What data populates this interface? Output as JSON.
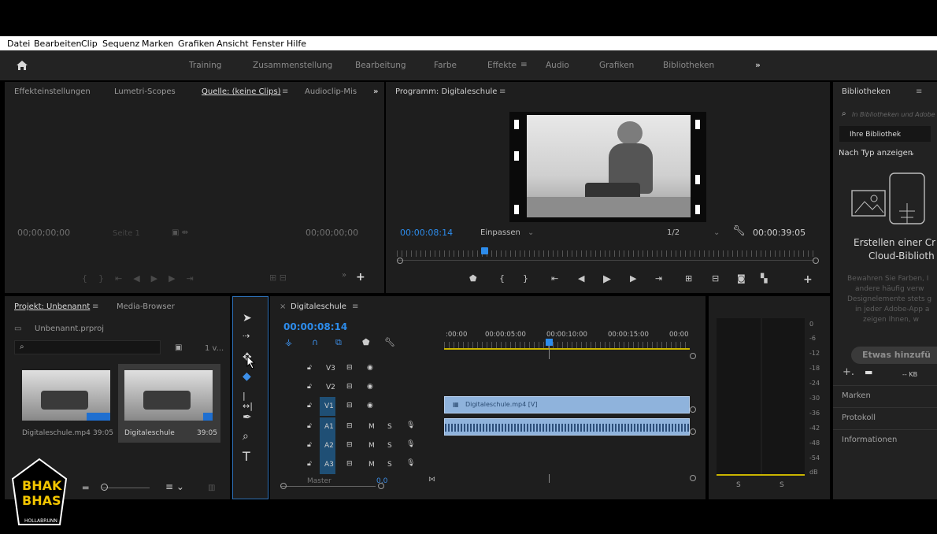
{
  "menu": [
    "Datei",
    "Bearbeiten",
    "Clip",
    "Sequenz",
    "Marken",
    "Grafiken",
    "Ansicht",
    "Fenster",
    "Hilfe"
  ],
  "workspaces": {
    "items": [
      "Training",
      "Zusammenstellung",
      "Bearbeitung",
      "Farbe",
      "Effekte",
      "Audio",
      "Grafiken",
      "Bibliotheken"
    ],
    "active": "Effekte",
    "more": "»"
  },
  "source_panel": {
    "tabs": [
      "Effekteinstellungen",
      "Lumetri-Scopes",
      "Quelle: (keine Clips)",
      "Audioclip-Mis"
    ],
    "active_tab": "Quelle: (keine Clips)",
    "timecode_left": "00;00;00;00",
    "page": "Seite 1",
    "timecode_right": "00;00;00;00"
  },
  "program_panel": {
    "title": "Programm: Digitaleschule",
    "timecode": "00:00:08:14",
    "fit": "Einpassen",
    "resolution": "1/2",
    "duration": "00:00:39:05",
    "playhead_fraction": 0.21
  },
  "libraries_panel": {
    "title": "Bibliotheken",
    "search_placeholder": "In Bibliotheken und Adobe",
    "library": "Ihre Bibliothek",
    "filter": "Nach Typ anzeigen",
    "heading": "Erstellen einer Cloud-Bibliothek",
    "heading_line1": "Erstellen einer Cr",
    "heading_line2": "Cloud-Biblioth",
    "desc_lines": [
      "Bewahren Sie Farben, I",
      "andere häufig verw",
      "Designelemente stets g",
      "in jeder Adobe-App a",
      "zeigen Ihnen, w"
    ],
    "add_button": "Etwas hinzufü",
    "kb": "-- KB",
    "sections": [
      "Marken",
      "Protokoll",
      "Informationen"
    ]
  },
  "project_panel": {
    "tabs": [
      "Projekt: Unbenannt",
      "Media-Browser"
    ],
    "file": "Unbenannt.prproj",
    "count": "1 v...",
    "items": [
      {
        "name": "Digitaleschule.mp4",
        "duration": "39:05"
      },
      {
        "name": "Digitaleschule",
        "duration": "39:05"
      }
    ]
  },
  "timeline": {
    "tab": "Digitaleschule",
    "timecode": "00:00:08:14",
    "ruler_labels": [
      ":00:00",
      "00:00:05:00",
      "00:00:10:00",
      "00:00:15:00",
      "00:00"
    ],
    "tracks": [
      {
        "label": "V3",
        "type": "video"
      },
      {
        "label": "V2",
        "type": "video"
      },
      {
        "label": "V1",
        "type": "video"
      },
      {
        "label": "A1",
        "type": "audio"
      },
      {
        "label": "A2",
        "type": "audio"
      },
      {
        "label": "A3",
        "type": "audio"
      }
    ],
    "master": "Master",
    "master_value": "0,0",
    "clip_label": "Digitaleschule.mp4 [V]"
  },
  "audio_meter": {
    "scale": [
      "0",
      "-6",
      "-12",
      "-18",
      "-24",
      "-30",
      "-36",
      "-42",
      "-48",
      "-54",
      "dB"
    ],
    "solo": [
      "S",
      "S"
    ]
  },
  "logo": {
    "line1": "BHAK",
    "line2": "BHAS",
    "line3": "HOLLABRUNN"
  },
  "colors": {
    "accent": "#2d8ceb",
    "panel": "#1e1e1e",
    "clip": "#8fb3dc"
  }
}
